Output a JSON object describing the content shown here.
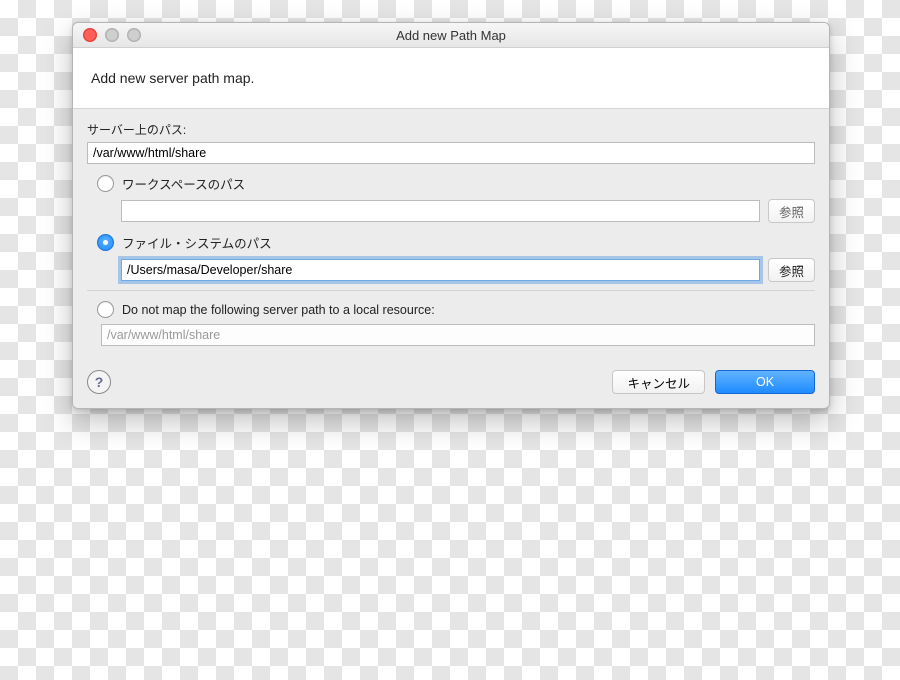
{
  "window": {
    "title": "Add new Path Map"
  },
  "header": {
    "message": "Add new server path map."
  },
  "server_path": {
    "label": "サーバー上のパス:",
    "value": "/var/www/html/share"
  },
  "options": {
    "workspace": {
      "label": "ワークスペースのパス",
      "selected": false,
      "input_value": "",
      "browse_label": "参照",
      "browse_enabled": false
    },
    "filesystem": {
      "label": "ファイル・システムのパス",
      "selected": true,
      "input_value": "/Users/masa/Developer/share",
      "browse_label": "参照",
      "browse_enabled": true
    },
    "do_not_map": {
      "label": "Do not map the following server path to a local resource:",
      "selected": false,
      "input_value": "/var/www/html/share"
    }
  },
  "footer": {
    "help_glyph": "?",
    "cancel": "キャンセル",
    "ok": "OK"
  }
}
